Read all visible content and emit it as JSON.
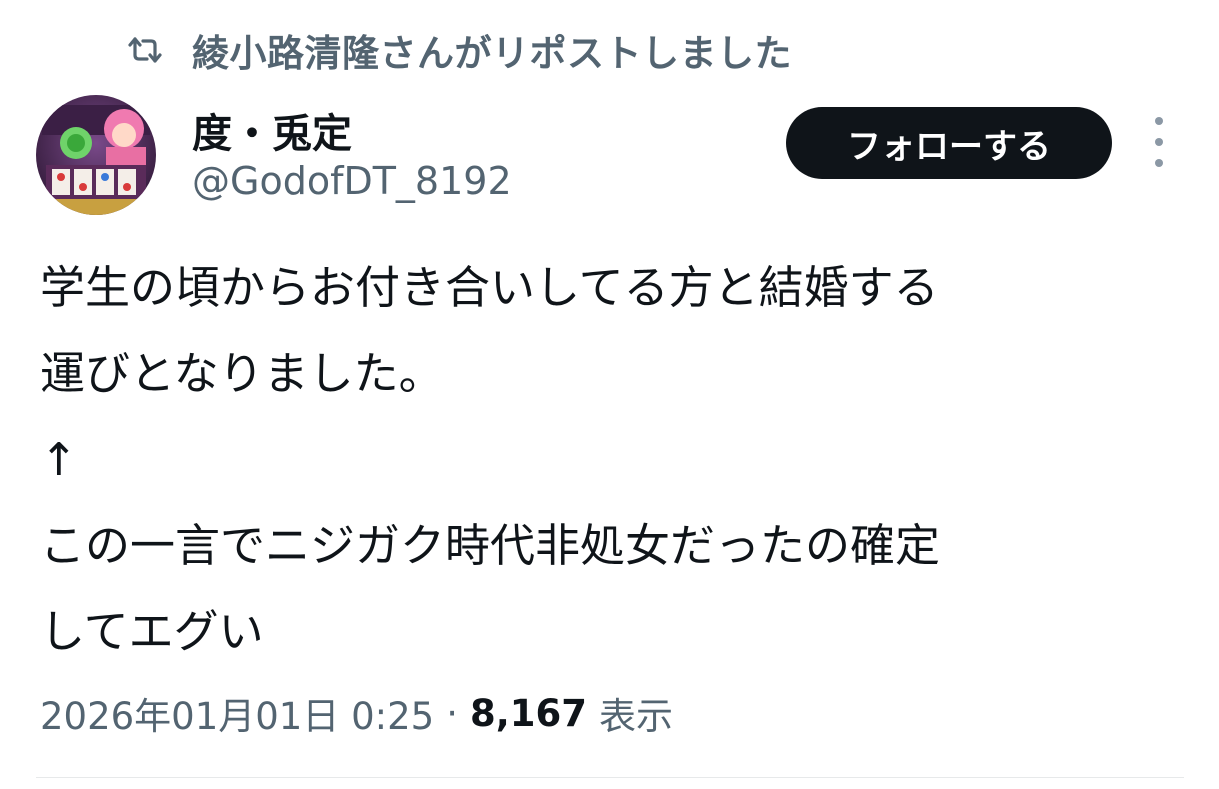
{
  "repost": {
    "icon": "repost-icon",
    "text": "綾小路清隆さんがリポストしました"
  },
  "author": {
    "display_name": "度・兎定",
    "handle": "@GodofDT_8192",
    "avatar": "avatar"
  },
  "follow_label": "フォローする",
  "more_icon": "more-vertical-icon",
  "tweet": {
    "lines": [
      "学生の頃からお付き合いしてる方と結婚する",
      "運びとなりました。",
      "↑",
      "この一言でニジガク時代非処女だったの確定",
      "してエグい"
    ]
  },
  "meta": {
    "datetime": "2026年01月01日 0:25",
    "separator": "·",
    "views_count": "8,167",
    "views_label": "表示"
  },
  "colors": {
    "text_primary": "#0f1419",
    "text_secondary": "#536471",
    "button_bg": "#0f1419",
    "divider": "#e7e9ea"
  }
}
